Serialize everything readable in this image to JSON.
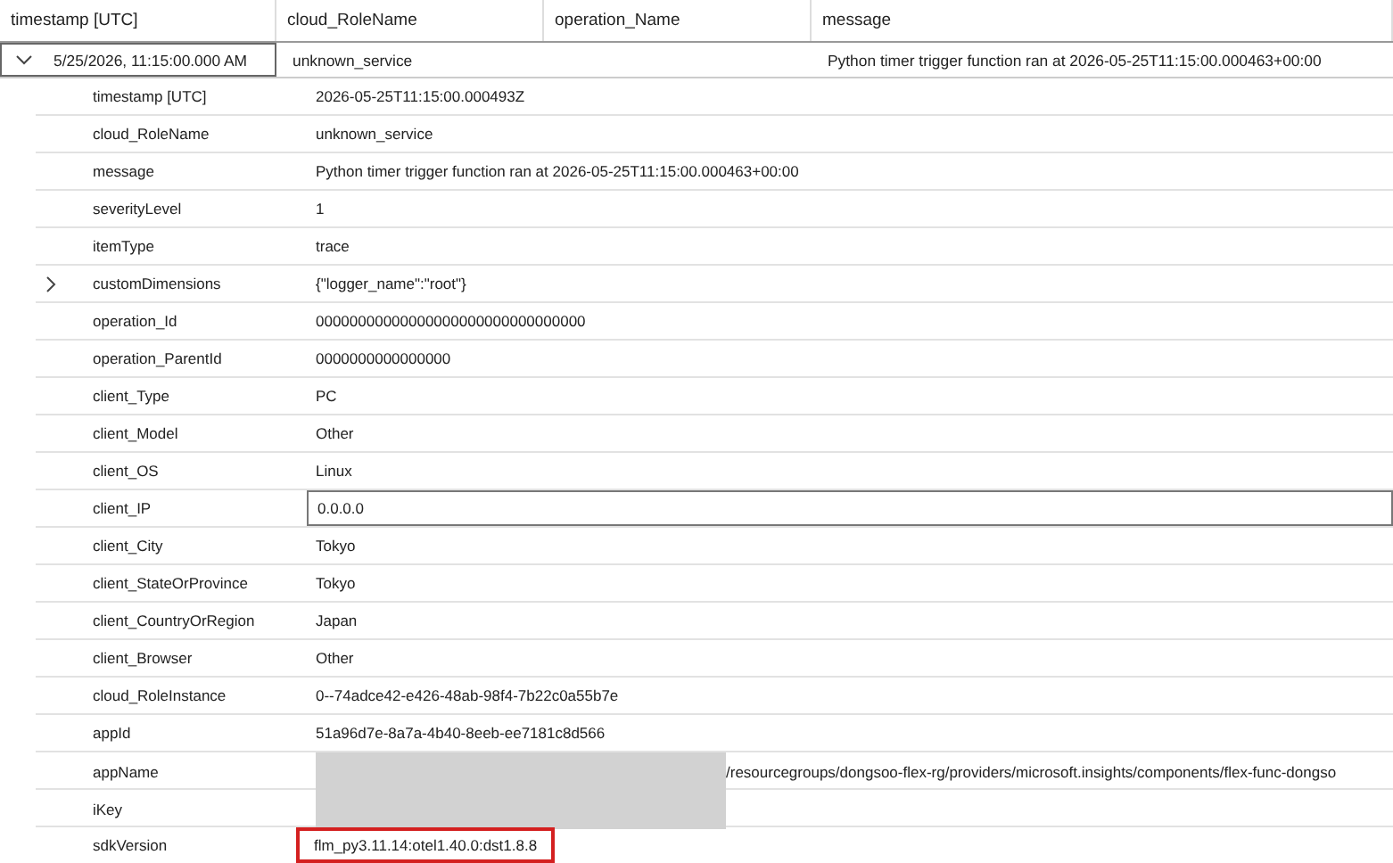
{
  "columns": [
    "timestamp [UTC]",
    "cloud_RoleName",
    "operation_Name",
    "message"
  ],
  "row": {
    "expanded": true,
    "cells": [
      {
        "text": "5/25/2026, 11:15:00.000 AM",
        "focused": true
      },
      {
        "text": "unknown_service",
        "focused": false
      },
      {
        "text": "",
        "focused": false
      },
      {
        "text": "Python timer trigger function ran at 2026-05-25T11:15:00.000463+00:00",
        "focused": false
      }
    ]
  },
  "details": [
    {
      "key": "timestamp [UTC]",
      "value": "2026-05-25T11:15:00.000493Z"
    },
    {
      "key": "cloud_RoleName",
      "value": "unknown_service"
    },
    {
      "key": "message",
      "value": "Python timer trigger function ran at 2026-05-25T11:15:00.000463+00:00"
    },
    {
      "key": "severityLevel",
      "value": "1"
    },
    {
      "key": "itemType",
      "value": "trace"
    },
    {
      "key": "customDimensions",
      "value": "{\"logger_name\":\"root\"}",
      "expanded": false
    },
    {
      "key": "operation_Id",
      "value": "00000000000000000000000000000000"
    },
    {
      "key": "operation_ParentId",
      "value": "0000000000000000"
    },
    {
      "key": "client_Type",
      "value": "PC"
    },
    {
      "key": "client_Model",
      "value": "Other"
    },
    {
      "key": "client_OS",
      "value": "Linux"
    },
    {
      "key": "client_IP",
      "value": "0.0.0.0",
      "focused": true
    },
    {
      "key": "client_City",
      "value": "Tokyo"
    },
    {
      "key": "client_StateOrProvince",
      "value": "Tokyo"
    },
    {
      "key": "client_CountryOrRegion",
      "value": "Japan"
    },
    {
      "key": "client_Browser",
      "value": "Other"
    },
    {
      "key": "cloud_RoleInstance",
      "value": "0--74adce42-e426-48ab-98f4-7b22c0a55b7e"
    },
    {
      "key": "appId",
      "value": "51a96d7e-8a7a-4b40-8eeb-ee7181c8d566"
    },
    {
      "key": "appName",
      "value": "/resourcegroups/dongsoo-flex-rg/providers/microsoft.insights/components/flex-func-dongso",
      "redacted": true
    },
    {
      "key": "iKey",
      "redacted": true
    },
    {
      "key": "sdkVersion",
      "value": "flm_py3.11.14:otel1.40.0:dst1.8.8",
      "highlighted": true
    }
  ]
}
